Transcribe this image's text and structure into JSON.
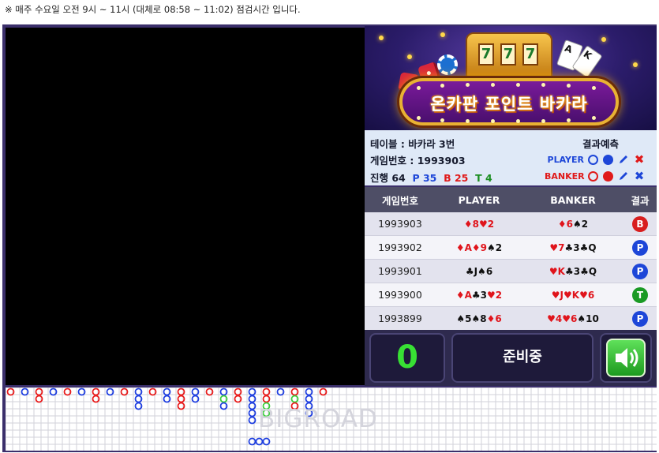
{
  "notice": "※ 매주 수요일 오전 9시 ~ 11시 (대체로 08:58 ~ 11:02) 점검시간 입니다.",
  "banner": {
    "title": "온카판 포인트 바카라",
    "slot_digits": [
      "7",
      "7",
      "7"
    ]
  },
  "info": {
    "table_label": "테이블 : 바카라 3번",
    "game_label": "게임번호 : 1993903",
    "progress_label": "진행 64",
    "player_count": "P 35",
    "banker_count": "B 25",
    "tie_count": "T 4",
    "prediction_title": "결과예측",
    "prediction_player": "PLAYER",
    "prediction_banker": "BANKER"
  },
  "history": {
    "headers": [
      "게임번호",
      "PLAYER",
      "BANKER",
      "결과"
    ],
    "rows": [
      {
        "game": "1993903",
        "player": [
          [
            "♦",
            "8"
          ],
          [
            "♥",
            "2"
          ]
        ],
        "banker": [
          [
            "♦",
            "6"
          ],
          [
            "♠",
            "2"
          ]
        ],
        "result": "B"
      },
      {
        "game": "1993902",
        "player": [
          [
            "♦",
            "A"
          ],
          [
            "♦",
            "9"
          ],
          [
            "♠",
            "2"
          ]
        ],
        "banker": [
          [
            "♥",
            "7"
          ],
          [
            "♣",
            "3"
          ],
          [
            "♣",
            "Q"
          ]
        ],
        "result": "P"
      },
      {
        "game": "1993901",
        "player": [
          [
            "♣",
            "J"
          ],
          [
            "♠",
            "6"
          ]
        ],
        "banker": [
          [
            "♥",
            "K"
          ],
          [
            "♣",
            "3"
          ],
          [
            "♣",
            "Q"
          ]
        ],
        "result": "P"
      },
      {
        "game": "1993900",
        "player": [
          [
            "♦",
            "A"
          ],
          [
            "♣",
            "3"
          ],
          [
            "♥",
            "2"
          ]
        ],
        "banker": [
          [
            "♥",
            "J"
          ],
          [
            "♥",
            "K"
          ],
          [
            "♥",
            "6"
          ]
        ],
        "result": "T"
      },
      {
        "game": "1993899",
        "player": [
          [
            "♠",
            "5"
          ],
          [
            "♠",
            "8"
          ],
          [
            "♦",
            "6"
          ]
        ],
        "banker": [
          [
            "♥",
            "4"
          ],
          [
            "♥",
            "6"
          ],
          [
            "♠",
            "10"
          ]
        ],
        "result": "P"
      }
    ]
  },
  "controls": {
    "countdown": "0",
    "status": "준비중"
  },
  "road": {
    "watermark": "BIGROAD",
    "colors": {
      "banker": "#e81c1c",
      "player": "#1f3fe0",
      "tie": "#3ccf3c"
    },
    "columns": [
      [
        "B"
      ],
      [
        "P"
      ],
      [
        "B",
        "B"
      ],
      [
        "P"
      ],
      [
        "B"
      ],
      [
        "P"
      ],
      [
        "B",
        "B"
      ],
      [
        "P"
      ],
      [
        "B"
      ],
      [
        "P",
        "P",
        "P"
      ],
      [
        "B"
      ],
      [
        "P",
        "P"
      ],
      [
        "B",
        "B",
        "B"
      ],
      [
        "P",
        "P"
      ],
      [
        "B"
      ],
      [
        "P",
        "G",
        "P"
      ],
      [
        "B",
        "B"
      ],
      [
        "P",
        "P",
        "P",
        "P",
        "P"
      ],
      [
        "B",
        "B",
        "G",
        "G"
      ],
      [
        "P"
      ],
      [
        "B",
        "G",
        "B"
      ],
      [
        "P",
        "P",
        "P",
        "P"
      ],
      [
        "B"
      ]
    ],
    "tail": [
      "P",
      "P",
      "P"
    ]
  },
  "theme": {
    "panel": "#3b2f6b",
    "accent_green": "#38e034",
    "red": "#e01a1a",
    "blue": "#1d46d8"
  }
}
